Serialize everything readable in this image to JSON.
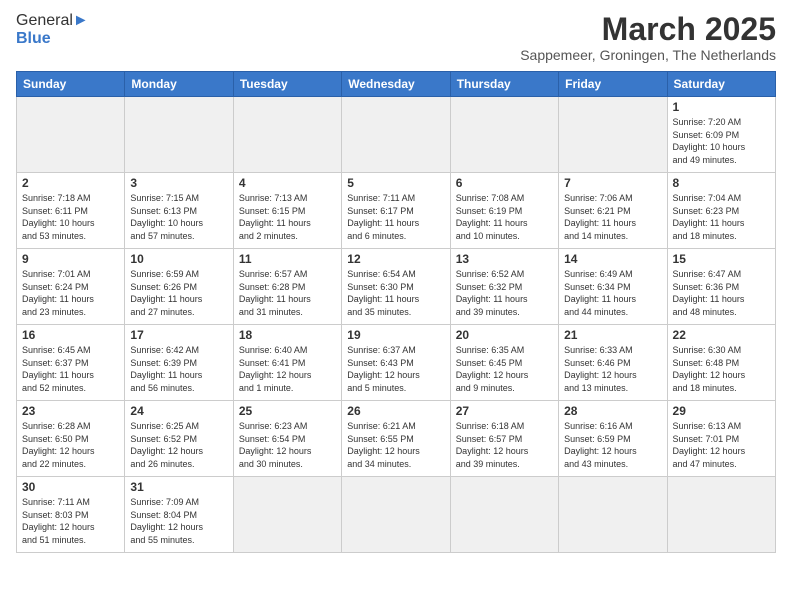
{
  "header": {
    "logo": {
      "general": "General",
      "blue": "Blue"
    },
    "title": "March 2025",
    "subtitle": "Sappemeer, Groningen, The Netherlands"
  },
  "weekdays": [
    "Sunday",
    "Monday",
    "Tuesday",
    "Wednesday",
    "Thursday",
    "Friday",
    "Saturday"
  ],
  "days": [
    {
      "num": "",
      "info": ""
    },
    {
      "num": "",
      "info": ""
    },
    {
      "num": "",
      "info": ""
    },
    {
      "num": "",
      "info": ""
    },
    {
      "num": "",
      "info": ""
    },
    {
      "num": "",
      "info": ""
    },
    {
      "num": "1",
      "info": "Sunrise: 7:20 AM\nSunset: 6:09 PM\nDaylight: 10 hours\nand 49 minutes."
    },
    {
      "num": "2",
      "info": "Sunrise: 7:18 AM\nSunset: 6:11 PM\nDaylight: 10 hours\nand 53 minutes."
    },
    {
      "num": "3",
      "info": "Sunrise: 7:15 AM\nSunset: 6:13 PM\nDaylight: 10 hours\nand 57 minutes."
    },
    {
      "num": "4",
      "info": "Sunrise: 7:13 AM\nSunset: 6:15 PM\nDaylight: 11 hours\nand 2 minutes."
    },
    {
      "num": "5",
      "info": "Sunrise: 7:11 AM\nSunset: 6:17 PM\nDaylight: 11 hours\nand 6 minutes."
    },
    {
      "num": "6",
      "info": "Sunrise: 7:08 AM\nSunset: 6:19 PM\nDaylight: 11 hours\nand 10 minutes."
    },
    {
      "num": "7",
      "info": "Sunrise: 7:06 AM\nSunset: 6:21 PM\nDaylight: 11 hours\nand 14 minutes."
    },
    {
      "num": "8",
      "info": "Sunrise: 7:04 AM\nSunset: 6:23 PM\nDaylight: 11 hours\nand 18 minutes."
    },
    {
      "num": "9",
      "info": "Sunrise: 7:01 AM\nSunset: 6:24 PM\nDaylight: 11 hours\nand 23 minutes."
    },
    {
      "num": "10",
      "info": "Sunrise: 6:59 AM\nSunset: 6:26 PM\nDaylight: 11 hours\nand 27 minutes."
    },
    {
      "num": "11",
      "info": "Sunrise: 6:57 AM\nSunset: 6:28 PM\nDaylight: 11 hours\nand 31 minutes."
    },
    {
      "num": "12",
      "info": "Sunrise: 6:54 AM\nSunset: 6:30 PM\nDaylight: 11 hours\nand 35 minutes."
    },
    {
      "num": "13",
      "info": "Sunrise: 6:52 AM\nSunset: 6:32 PM\nDaylight: 11 hours\nand 39 minutes."
    },
    {
      "num": "14",
      "info": "Sunrise: 6:49 AM\nSunset: 6:34 PM\nDaylight: 11 hours\nand 44 minutes."
    },
    {
      "num": "15",
      "info": "Sunrise: 6:47 AM\nSunset: 6:36 PM\nDaylight: 11 hours\nand 48 minutes."
    },
    {
      "num": "16",
      "info": "Sunrise: 6:45 AM\nSunset: 6:37 PM\nDaylight: 11 hours\nand 52 minutes."
    },
    {
      "num": "17",
      "info": "Sunrise: 6:42 AM\nSunset: 6:39 PM\nDaylight: 11 hours\nand 56 minutes."
    },
    {
      "num": "18",
      "info": "Sunrise: 6:40 AM\nSunset: 6:41 PM\nDaylight: 12 hours\nand 1 minute."
    },
    {
      "num": "19",
      "info": "Sunrise: 6:37 AM\nSunset: 6:43 PM\nDaylight: 12 hours\nand 5 minutes."
    },
    {
      "num": "20",
      "info": "Sunrise: 6:35 AM\nSunset: 6:45 PM\nDaylight: 12 hours\nand 9 minutes."
    },
    {
      "num": "21",
      "info": "Sunrise: 6:33 AM\nSunset: 6:46 PM\nDaylight: 12 hours\nand 13 minutes."
    },
    {
      "num": "22",
      "info": "Sunrise: 6:30 AM\nSunset: 6:48 PM\nDaylight: 12 hours\nand 18 minutes."
    },
    {
      "num": "23",
      "info": "Sunrise: 6:28 AM\nSunset: 6:50 PM\nDaylight: 12 hours\nand 22 minutes."
    },
    {
      "num": "24",
      "info": "Sunrise: 6:25 AM\nSunset: 6:52 PM\nDaylight: 12 hours\nand 26 minutes."
    },
    {
      "num": "25",
      "info": "Sunrise: 6:23 AM\nSunset: 6:54 PM\nDaylight: 12 hours\nand 30 minutes."
    },
    {
      "num": "26",
      "info": "Sunrise: 6:21 AM\nSunset: 6:55 PM\nDaylight: 12 hours\nand 34 minutes."
    },
    {
      "num": "27",
      "info": "Sunrise: 6:18 AM\nSunset: 6:57 PM\nDaylight: 12 hours\nand 39 minutes."
    },
    {
      "num": "28",
      "info": "Sunrise: 6:16 AM\nSunset: 6:59 PM\nDaylight: 12 hours\nand 43 minutes."
    },
    {
      "num": "29",
      "info": "Sunrise: 6:13 AM\nSunset: 7:01 PM\nDaylight: 12 hours\nand 47 minutes."
    },
    {
      "num": "30",
      "info": "Sunrise: 7:11 AM\nSunset: 8:03 PM\nDaylight: 12 hours\nand 51 minutes."
    },
    {
      "num": "31",
      "info": "Sunrise: 7:09 AM\nSunset: 8:04 PM\nDaylight: 12 hours\nand 55 minutes."
    }
  ]
}
